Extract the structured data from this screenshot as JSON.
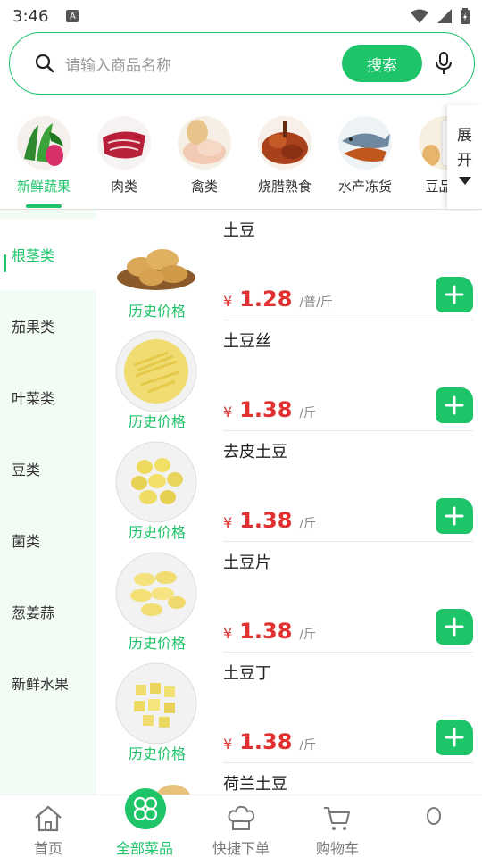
{
  "status": {
    "time": "3:46",
    "notif_icon": "a-icon"
  },
  "search": {
    "placeholder": "请输入商品名称",
    "button": "搜索"
  },
  "categories": [
    {
      "label": "新鲜蔬果",
      "icon": "vegetables-icon",
      "active": true
    },
    {
      "label": "肉类",
      "icon": "meat-icon"
    },
    {
      "label": "禽类",
      "icon": "poultry-icon"
    },
    {
      "label": "烧腊熟食",
      "icon": "roast-meat-icon"
    },
    {
      "label": "水产冻货",
      "icon": "seafood-icon"
    },
    {
      "label": "豆品蛋",
      "icon": "soy-egg-icon"
    }
  ],
  "expand": {
    "line1": "展",
    "line2": "开"
  },
  "sidebar": {
    "items": [
      {
        "label": "根茎类",
        "active": true
      },
      {
        "label": "茄果类"
      },
      {
        "label": "叶菜类"
      },
      {
        "label": "豆类"
      },
      {
        "label": "菌类"
      },
      {
        "label": "葱姜蒜"
      },
      {
        "label": "新鲜水果"
      }
    ]
  },
  "products": [
    {
      "name": "土豆",
      "history": "历史价格",
      "currency": "¥",
      "price": "1.28",
      "unit": "/普/斤"
    },
    {
      "name": "土豆丝",
      "history": "历史价格",
      "currency": "¥",
      "price": "1.38",
      "unit": "/斤"
    },
    {
      "name": "去皮土豆",
      "history": "历史价格",
      "currency": "¥",
      "price": "1.38",
      "unit": "/斤"
    },
    {
      "name": "土豆片",
      "history": "历史价格",
      "currency": "¥",
      "price": "1.38",
      "unit": "/斤"
    },
    {
      "name": "土豆丁",
      "history": "历史价格",
      "currency": "¥",
      "price": "1.38",
      "unit": "/斤"
    },
    {
      "name": "荷兰土豆"
    }
  ],
  "nav": {
    "items": [
      {
        "label": "首页",
        "icon": "home-icon"
      },
      {
        "label": "全部菜品",
        "icon": "clover-icon",
        "active": true
      },
      {
        "label": "快捷下单",
        "icon": "chef-hat-icon"
      },
      {
        "label": "购物车",
        "icon": "cart-icon"
      },
      {
        "label": "",
        "icon": "profile-icon"
      }
    ]
  },
  "colors": {
    "accent": "#1ec468",
    "price": "#e03030",
    "sidebar_bg": "#f3fbf5"
  }
}
